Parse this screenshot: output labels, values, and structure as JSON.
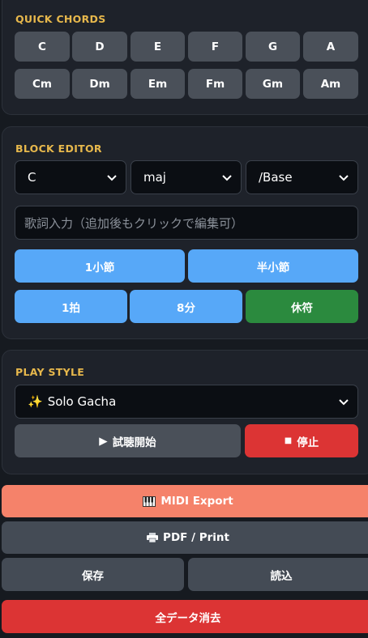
{
  "quick_chords": {
    "title": "QUICK CHORDS",
    "row1": [
      "C",
      "D",
      "E",
      "F",
      "G",
      "A"
    ],
    "row2": [
      "Cm",
      "Dm",
      "Em",
      "Fm",
      "Gm",
      "Am"
    ]
  },
  "block_editor": {
    "title": "BLOCK EDITOR",
    "root_select": "C",
    "quality_select": "maj",
    "bass_select": "/Base",
    "lyrics_placeholder": "歌詞入力（追加後もクリックで編集可）",
    "length_buttons": [
      "1小節",
      "半小節",
      "1拍",
      "8分"
    ],
    "rest_button": "休符"
  },
  "play_style": {
    "title": "PLAY STYLE",
    "style_select": "Solo Gacha",
    "style_icon": "sparkles-icon",
    "play_button": "試聴開始",
    "stop_button": "停止"
  },
  "actions": {
    "midi_export": "MIDI Export",
    "pdf_print": "PDF / Print",
    "save": "保存",
    "load": "読込",
    "clear_all": "全データ消去"
  },
  "colors": {
    "accent_title": "#e7b84c",
    "blue": "#57a8f8",
    "green": "#2b8a3e",
    "red": "#dc3434",
    "salmon": "#f5826a",
    "gray": "#4a5059"
  }
}
